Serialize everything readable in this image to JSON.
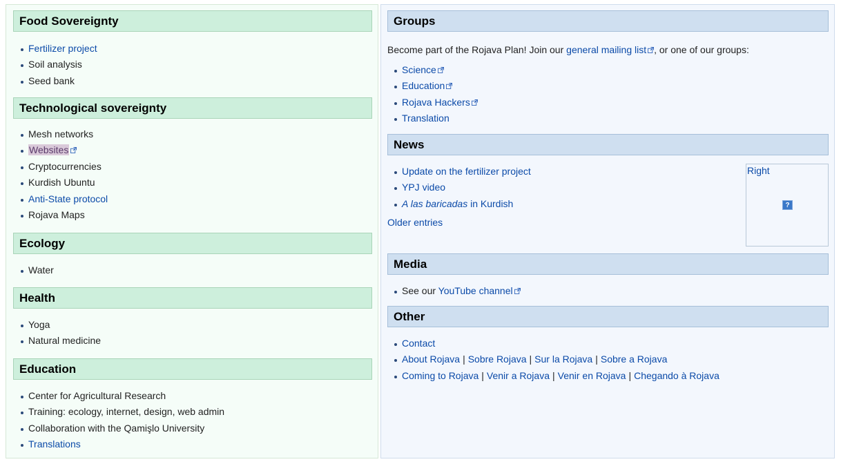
{
  "left": {
    "food": {
      "title": "Food Sovereignty",
      "items": [
        "Fertilizer project",
        "Soil analysis",
        "Seed bank"
      ]
    },
    "tech": {
      "title": "Technological sovereignty",
      "items": [
        "Mesh networks",
        "Websites",
        "Cryptocurrencies",
        "Kurdish Ubuntu",
        "Anti-State protocol",
        "Rojava Maps"
      ]
    },
    "ecology": {
      "title": "Ecology",
      "items": [
        "Water"
      ]
    },
    "health": {
      "title": "Health",
      "items": [
        "Yoga",
        "Natural medicine"
      ]
    },
    "education": {
      "title": "Education",
      "items": [
        "Center for Agricultural Research",
        "Training: ecology, internet, design, web admin",
        "Collaboration with the Qamişlo University",
        "Translations"
      ]
    }
  },
  "right": {
    "groups": {
      "title": "Groups",
      "intro_before": "Become part of the Rojava Plan! Join our ",
      "intro_link": "general mailing list",
      "intro_after": ", or one of our groups:",
      "items": [
        "Science",
        "Education",
        "Rojava Hackers",
        "Translation"
      ]
    },
    "news": {
      "title": "News",
      "items": [
        "Update on the fertilizer project",
        "YPJ video"
      ],
      "item3_italic": "A las baricadas",
      "item3_rest": " in Kurdish",
      "older": "Older entries",
      "box_label": "Right",
      "box_icon": "?"
    },
    "media": {
      "title": "Media",
      "see_our": "See our ",
      "youtube": "YouTube channel"
    },
    "other": {
      "title": "Other",
      "contact": "Contact",
      "about": [
        "About Rojava",
        "Sobre Rojava",
        "Sur la Rojava",
        "Sobre a Rojava"
      ],
      "coming": [
        "Coming to Rojava",
        "Venir a Rojava",
        "Venir en Rojava",
        "Chegando à Rojava"
      ],
      "separator": "|"
    }
  },
  "colors": {
    "link": "#0b4aa8",
    "left_header_bg": "#cdefdc",
    "right_header_bg": "#cfdff0"
  },
  "icons": {
    "external_link": "external-link-icon",
    "missing_image": "question-icon"
  }
}
